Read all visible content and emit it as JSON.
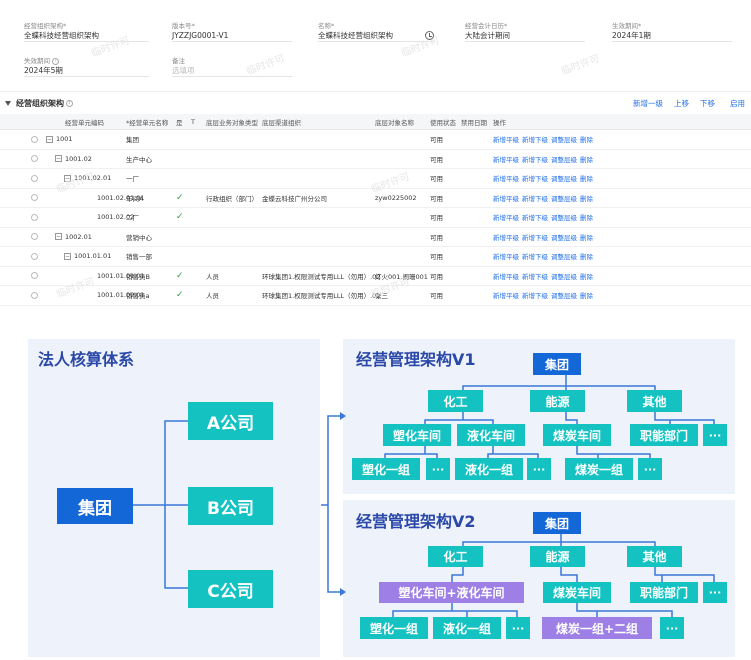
{
  "form": {
    "org_label": "经营组织架构*",
    "org_value": "全蝶科技经营组织架构",
    "version_label": "版本号*",
    "version_value": "JYZZJG0001-V1",
    "name_label": "名称*",
    "name_value": "全蝶科技经营组织架构",
    "calendar_label": "经营会计日历*",
    "calendar_value": "大陆会计期间",
    "effective_label": "生效期间*",
    "effective_value": "2024年1期",
    "expire_label": "失效期间",
    "expire_value": "2024年5期",
    "remark_label": "备注",
    "remark_placeholder": "选填项",
    "watermark": "临时许可"
  },
  "section": {
    "title": "经营组织架构",
    "buttons": [
      "新增一级",
      "上移",
      "下移",
      "启用"
    ]
  },
  "grid": {
    "headers": [
      "经营单元编码",
      "*经营单元名称",
      "是",
      "T",
      "底层业务对象类型",
      "底层渠道组织",
      "底层对象名称",
      "使用状态",
      "禁用日期",
      "操作"
    ],
    "rows": [
      {
        "code": "1001",
        "name": "集团",
        "check": false,
        "type": "",
        "org": "",
        "obj": "",
        "status": "可用",
        "expanded": true
      },
      {
        "code": "1001.02",
        "name": "生产中心",
        "check": false,
        "type": "",
        "org": "",
        "obj": "",
        "status": "可用",
        "expanded": true
      },
      {
        "code": "1001.02.01",
        "name": "一厂",
        "check": false,
        "type": "",
        "org": "",
        "obj": "",
        "status": "可用",
        "expanded": true
      },
      {
        "code": "1001.02.01.01",
        "name": "车间A",
        "check": true,
        "type": "行政组织（部门）",
        "org": "金蝶云科技广州分公司",
        "obj": "zyw0225002",
        "status": "可用",
        "expanded": null
      },
      {
        "code": "1001.02.02",
        "name": "二厂",
        "check": true,
        "type": "",
        "org": "",
        "obj": "",
        "status": "可用",
        "expanded": null
      },
      {
        "code": "1002.01",
        "name": "营销中心",
        "check": false,
        "type": "",
        "org": "",
        "obj": "",
        "status": "可用",
        "expanded": true
      },
      {
        "code": "1001.01.01",
        "name": "销售一部",
        "check": false,
        "type": "",
        "org": "",
        "obj": "",
        "status": "可用",
        "expanded": true
      },
      {
        "code": "1001.01.01.01",
        "name": "销售员B",
        "check": true,
        "type": "人员",
        "org": "环球集团1.权限测试专用LLL（勿用）.02",
        "obj": "灯火001.阑珊001",
        "status": "可用",
        "expanded": null
      },
      {
        "code": "1001.01.02.01",
        "name": "销售员a",
        "check": true,
        "type": "人员",
        "org": "环球集团1.权限测试专用LLL（勿用）.02",
        "obj": "张三",
        "status": "可用",
        "expanded": null
      }
    ],
    "ops": [
      "新增平级",
      "新增下级",
      "调整层级",
      "删除"
    ]
  },
  "diagram": {
    "legal_title": "法人核算体系",
    "legal_root": "集团",
    "legal_children": [
      "A公司",
      "B公司",
      "C公司"
    ],
    "v1_title": "经营管理架构V1",
    "v1_root": "集团",
    "v1_level1": [
      "化工",
      "能源",
      "其他"
    ],
    "v1_level2": [
      "塑化车间",
      "液化车间",
      "煤炭车间",
      "职能部门",
      "···"
    ],
    "v1_level3": [
      "塑化一组",
      "···",
      "液化一组",
      "···",
      "煤炭一组",
      "···"
    ],
    "v2_title": "经营管理架构V2",
    "v2_root": "集团",
    "v2_level1": [
      "化工",
      "能源",
      "其他"
    ],
    "v2_level2": [
      "塑化车间+液化车间",
      "煤炭车间",
      "职能部门",
      "···"
    ],
    "v2_level3": [
      "塑化一组",
      "液化一组",
      "···",
      "煤炭一组+二组",
      "···"
    ]
  }
}
